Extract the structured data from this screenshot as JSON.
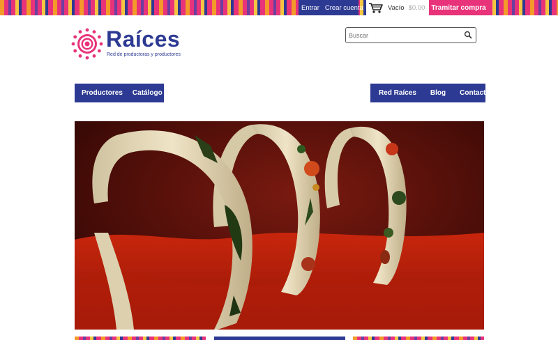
{
  "header": {
    "account_links": [
      "Entrar",
      "Crear cuenta"
    ],
    "cart": {
      "label": "Vacío",
      "amount": "$0.00"
    },
    "checkout_label": "Tramitar compra"
  },
  "logo": {
    "name": "Raíces",
    "tagline": "Red de productoras y productores",
    "colors": {
      "brand_blue": "#2d3a93",
      "brand_pink": "#e8337a"
    }
  },
  "search": {
    "placeholder": "Buscar",
    "icon": "magnifier-icon"
  },
  "nav": {
    "left": [
      "Productores",
      "Catálogo"
    ],
    "right": [
      "Red Raíces",
      "Blog",
      "Contacto"
    ]
  },
  "hero": {
    "image": "embroidered-headbands-photo"
  },
  "colors": {
    "accent_blue": "#2d3a93",
    "accent_pink": "#e8337a",
    "accent_orange": "#f39a2a"
  }
}
